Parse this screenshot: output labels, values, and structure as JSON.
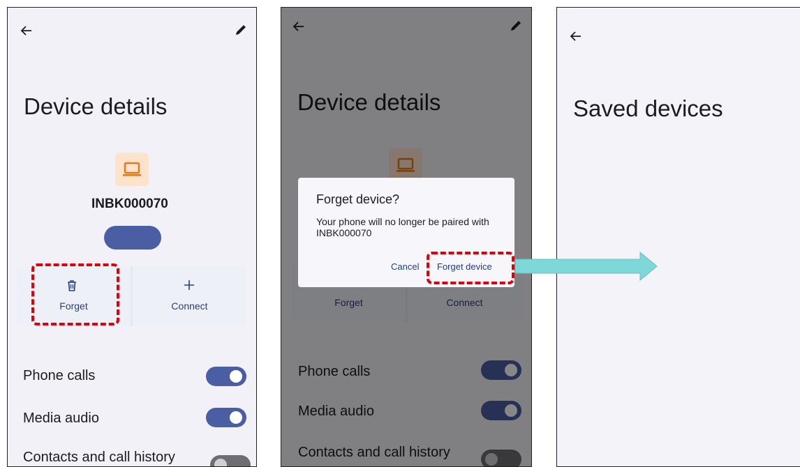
{
  "screens": [
    {
      "title": "Device details",
      "device_name": "INBK000070",
      "actions": [
        {
          "label": "Forget",
          "icon": "trash-icon"
        },
        {
          "label": "Connect",
          "icon": "plus-icon"
        }
      ],
      "settings": [
        {
          "label": "Phone calls",
          "on": true
        },
        {
          "label": "Media audio",
          "on": true
        },
        {
          "label": "Contacts and call history",
          "on": false
        }
      ]
    },
    {
      "title": "Device details",
      "actions": [
        {
          "label": "Forget"
        },
        {
          "label": "Connect"
        }
      ],
      "settings": [
        {
          "label": "Phone calls"
        },
        {
          "label": "Media audio"
        },
        {
          "label": "Contacts and call history"
        }
      ],
      "dialog": {
        "title": "Forget device?",
        "message": "Your phone will no longer be paired with INBK000070",
        "cancel_label": "Cancel",
        "confirm_label": "Forget device"
      }
    },
    {
      "title": "Saved devices"
    }
  ],
  "colors": {
    "toggle_on": "#4b5ea3",
    "highlight": "#e0000c",
    "arrow": "#7fd8d8",
    "device_icon_bg": "#fde2cc",
    "device_icon": "#e07b1a"
  }
}
